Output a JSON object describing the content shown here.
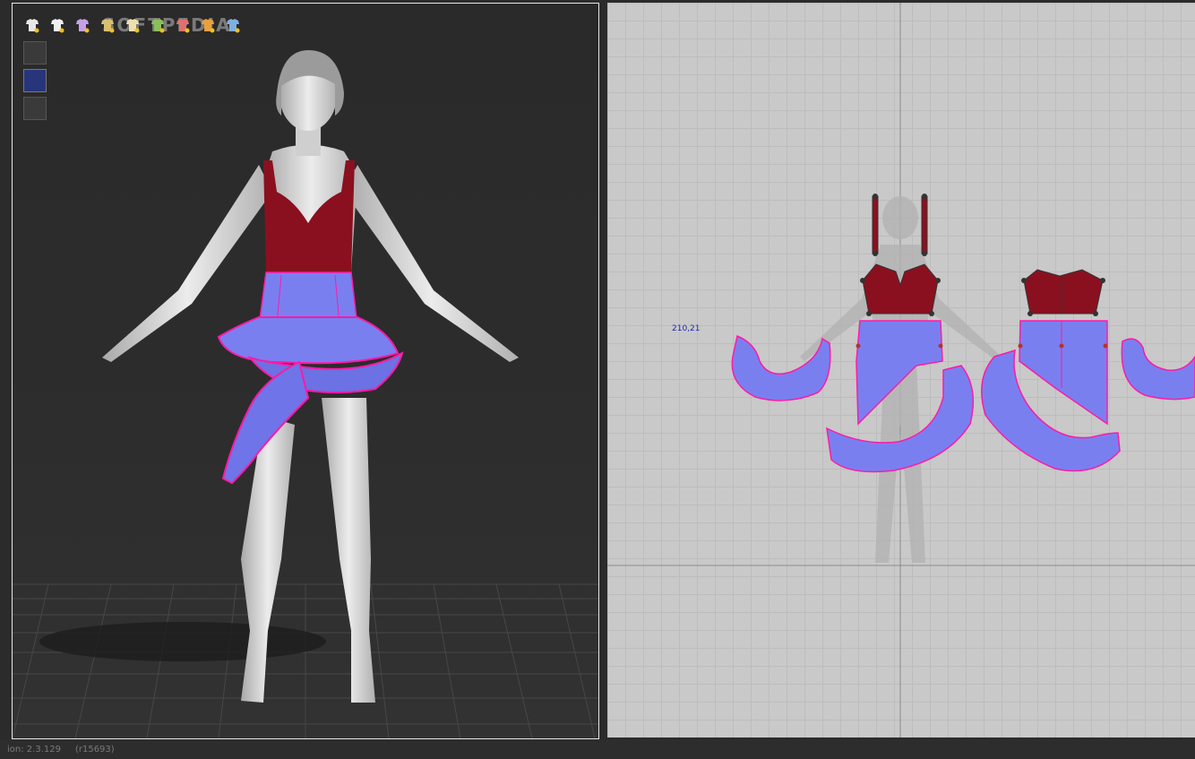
{
  "app": {
    "watermark": "SOFTPEDIA"
  },
  "toolbar3d": {
    "items": [
      {
        "name": "tshirt-icon"
      },
      {
        "name": "tshirt-pin-icon"
      },
      {
        "name": "dotted-shirt-icon"
      },
      {
        "name": "stitch-icon"
      },
      {
        "name": "shirt-layers-icon"
      },
      {
        "name": "ruler-icon"
      },
      {
        "name": "pin-icon"
      },
      {
        "name": "button-icon"
      },
      {
        "name": "texture-icon"
      }
    ]
  },
  "side_tools": [
    {
      "name": "avatar-pose-icon",
      "active": false
    },
    {
      "name": "blue-garment-icon",
      "active": true
    },
    {
      "name": "avatar-head-icon",
      "active": false
    }
  ],
  "pattern_view": {
    "coord_label": "210,21"
  },
  "status": {
    "version": "ion: 2.3.129",
    "revision": "(r15693)"
  },
  "colors": {
    "denim": "#7a7ff0",
    "top_red": "#8a1020",
    "seam_pink": "#ff1aa8"
  }
}
